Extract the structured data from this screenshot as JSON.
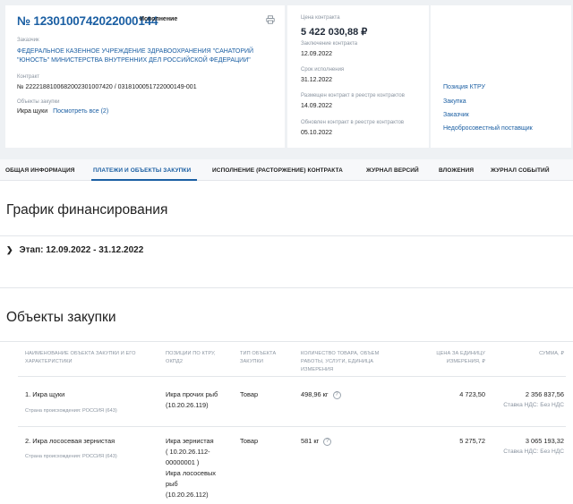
{
  "header": {
    "number": "№ 1230100742022000144",
    "status": "Исполнение",
    "customer_label": "Заказчик",
    "customer_name": "ФЕДЕРАЛЬНОЕ КАЗЕННОЕ УЧРЕЖДЕНИЕ ЗДРАВООХРАНЕНИЯ \"САНАТОРИЙ \"ЮНОСТЬ\" МИНИСТЕРСТВА ВНУТРЕННИХ ДЕЛ РОССИЙСКОЙ ФЕДЕРАЦИИ\"",
    "contract_label": "Контракт",
    "contract_value": "№ 2222188100682002301007420 / 0318100051722000149-001",
    "objects_label": "Объекты закупки",
    "objects_value": "Икра щуки",
    "objects_link": "Посмотреть все (2)"
  },
  "details": {
    "price_label": "Цена контракта",
    "price_value": "5 422 030,88 ₽",
    "conclusion_label": "Заключение контракта",
    "conclusion_value": "12.09.2022",
    "term_label": "Срок исполнения",
    "term_value": "31.12.2022",
    "registry_label": "Размещен контракт в реестре контрактов",
    "registry_value": "14.09.2022",
    "updated_label": "Обновлен контракт в реестре контрактов",
    "updated_value": "05.10.2022"
  },
  "links": {
    "ktru": "Позиция КТРУ",
    "purchase": "Закупка",
    "customer": "Заказчик",
    "supplier": "Недобросовестный поставщик"
  },
  "tabs": [
    "ОБЩАЯ ИНФОРМАЦИЯ",
    "ПЛАТЕЖИ И ОБЪЕКТЫ ЗАКУПКИ",
    "ИСПОЛНЕНИЕ (РАСТОРЖЕНИЕ) КОНТРАКТА",
    "ЖУРНАЛ ВЕРСИЙ",
    "ВЛОЖЕНИЯ",
    "ЖУРНАЛ СОБЫТИЙ"
  ],
  "schedule": {
    "title": "График финансирования",
    "stage": "Этап: 12.09.2022 - 31.12.2022"
  },
  "objects": {
    "title": "Объекты закупки",
    "columns": [
      "НАИМЕНОВАНИЕ ОБЪЕКТА ЗАКУПКИ И ЕГО ХАРАКТЕРИСТИКИ",
      "ПОЗИЦИИ ПО КТРУ, ОКПД2",
      "ТИП ОБЪЕКТА ЗАКУПКИ",
      "КОЛИЧЕСТВО ТОВАРА, ОБЪЕМ РАБОТЫ, УСЛУГИ, ЕДИНИЦА ИЗМЕРЕНИЯ",
      "ЦЕНА ЗА ЕДИНИЦУ ИЗМЕРЕНИЯ, ₽",
      "СУММА, ₽"
    ],
    "rows": [
      {
        "name": "1. Икра щуки",
        "origin": "Страна происхождения: РОССИЯ (643)",
        "pos1": "Икра прочих рыб",
        "pos2": "(10.20.26.119)",
        "type": "Товар",
        "qty": "498,96 кг",
        "unit_price": "4 723,50",
        "sum": "2 356 837,56",
        "vat": "Ставка НДС: Без НДС"
      },
      {
        "name": "2. Икра лососевая зернистая",
        "origin": "Страна происхождения: РОССИЯ (643)",
        "pos1": "Икра зернистая",
        "pos_link1": "( 10.20.26.112-",
        "pos_link2": "00000001 )",
        "pos3": "Икра лососевых",
        "pos4": "рыб",
        "pos5": "(10.20.26.112)",
        "type": "Товар",
        "qty": "581 кг",
        "unit_price": "5 275,72",
        "sum": "3 065 193,32",
        "vat": "Ставка НДС: Без НДС"
      }
    ]
  }
}
